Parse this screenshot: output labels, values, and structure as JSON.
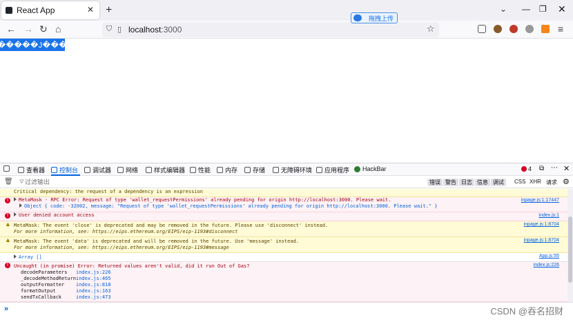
{
  "browser": {
    "tab_title": "React App",
    "url_host": "localhost",
    "url_port": ":3000",
    "upload_pill": "拖拽上传"
  },
  "page": {
    "button_label": "�����J���"
  },
  "devtools": {
    "tabs": [
      "查看器",
      "控制台",
      "调试器",
      "网络",
      "样式编辑器",
      "性能",
      "内存",
      "存储",
      "无障碍环境",
      "应用程序",
      "HackBar"
    ],
    "active_tab": "控制台",
    "error_count": "4",
    "filter_placeholder": "过滤输出",
    "filters": [
      "错误",
      "警告",
      "日志",
      "信息",
      "调试"
    ],
    "filter_extra": [
      "CSS",
      "XHR",
      "请求"
    ],
    "messages": [
      {
        "type": "warn",
        "lines": [
          "Critical dependency: the request of a dependency is an expression"
        ],
        "loc": ""
      },
      {
        "type": "err",
        "lines": [
          "MetaMask - RPC Error: Request of type 'wallet_requestPermissions' already pending for origin http://localhost:3000. Please wait.",
          "Object { code: -32002, message: \"Request of type 'wallet_requestPermissions' already pending for origin http://localhost:3000. Please wait.\" }"
        ],
        "loc": "inpage.js:1:17447"
      },
      {
        "type": "err",
        "lines": [
          "User denied account access"
        ],
        "loc": "index.js:1"
      },
      {
        "type": "warn",
        "lines": [
          "MetaMask: The event 'close' is deprecated and may be removed in the future. Please use 'disconnect' instead.",
          "For more information, see: https://eips.ethereum.org/EIPS/eip-1193#disconnect"
        ],
        "loc": "inpage.js:1:8704"
      },
      {
        "type": "warn",
        "lines": [
          "MetaMask: The event 'data' is deprecated and will be removed in the future. Use 'message' instead.",
          "For more information, see: https://eips.ethereum.org/EIPS/eip-1193#message"
        ],
        "loc": "inpage.js:1:8704"
      },
      {
        "type": "plain",
        "lines": [
          "Array []"
        ],
        "loc": "App.js:55"
      },
      {
        "type": "err",
        "lines": [
          "Uncaught (in promise) Error: Returned values aren't valid, did it run Out of Gas?"
        ],
        "loc": "index.js:226"
      }
    ],
    "stack": [
      {
        "fn": "decodeParameters",
        "src": "index.js:226"
      },
      {
        "fn": "_decodeMethodReturn",
        "src": "index.js:465"
      },
      {
        "fn": "outputFormatter",
        "src": "index.js:818"
      },
      {
        "fn": "formatOutput",
        "src": "index.js:163"
      },
      {
        "fn": "sendTxCallback",
        "src": "index.js:473"
      }
    ],
    "prompt": "»"
  },
  "watermark": "CSDN @吞名招财"
}
